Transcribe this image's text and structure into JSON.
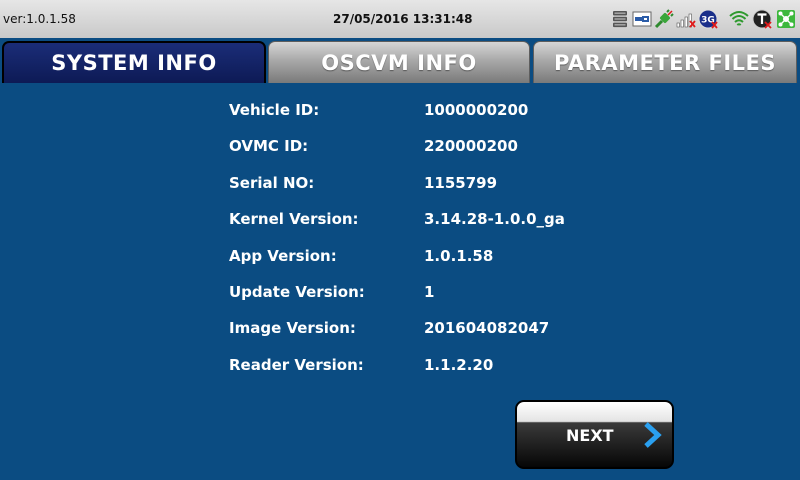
{
  "status_bar": {
    "version": "ver:1.0.1.58",
    "datetime": "27/05/2016 13:31:48",
    "icons": [
      "storage-icon",
      "usb-key-icon",
      "connector-icon",
      "signal-bars-icon",
      "3g-icon",
      "wifi-icon",
      "transmission-icon",
      "network-status-icon"
    ],
    "icon_colors": {
      "3g_badge": "#1a2f8a",
      "wifi": "#2f9a2f",
      "network": "#3db83d",
      "alert_x": "#e01b1b"
    }
  },
  "tabs": [
    {
      "label": "SYSTEM INFO",
      "active": true
    },
    {
      "label": "OSCVM INFO",
      "active": false
    },
    {
      "label": "PARAMETER FILES",
      "active": false
    }
  ],
  "info": [
    {
      "label": "Vehicle ID:",
      "value": "1000000200"
    },
    {
      "label": "OVMC ID:",
      "value": "220000200"
    },
    {
      "label": "Serial NO:",
      "value": "1155799"
    },
    {
      "label": "Kernel Version:",
      "value": "3.14.28-1.0.0_ga"
    },
    {
      "label": "App Version:",
      "value": "1.0.1.58"
    },
    {
      "label": "Update Version:",
      "value": "1"
    },
    {
      "label": "Image Version:",
      "value": "201604082047"
    },
    {
      "label": "Reader Version:",
      "value": "1.1.2.20"
    }
  ],
  "next_button": {
    "label": "NEXT",
    "icon": "chevron-right-icon"
  },
  "colors": {
    "background": "#0b4c82",
    "active_tab": "#13246a",
    "chevron": "#2aa0f0",
    "text": "#ffffff"
  }
}
